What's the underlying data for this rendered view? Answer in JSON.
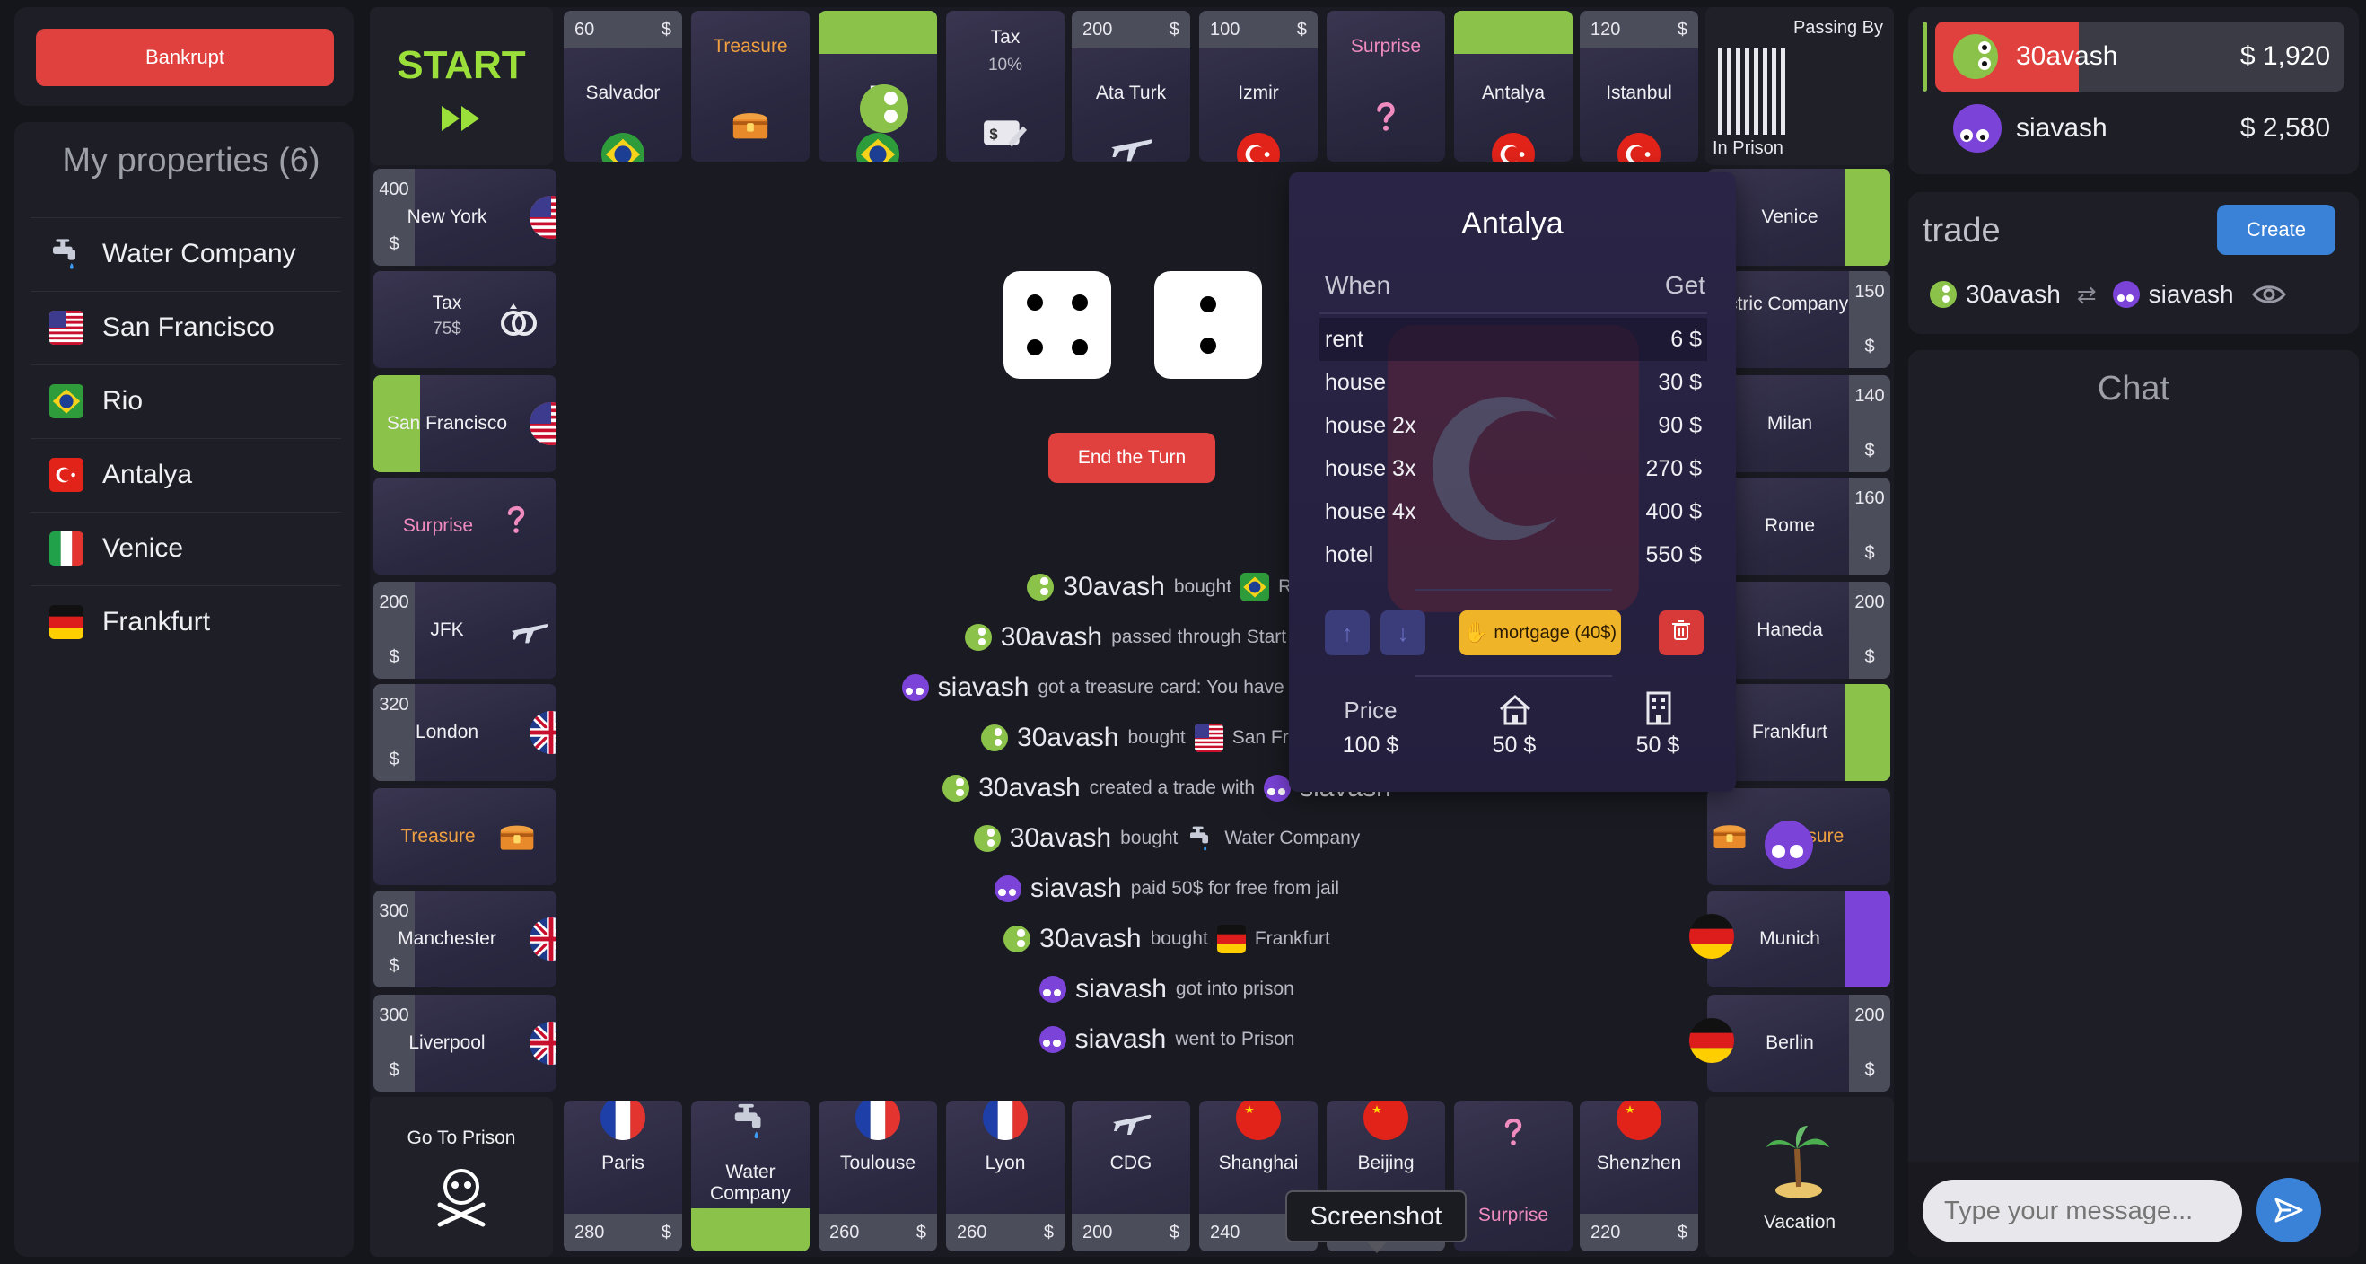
{
  "sidebar": {
    "bankrupt": "Bankrupt",
    "props_title": "My properties (6)",
    "properties": [
      {
        "label": "Water Company",
        "icon": "water-tap-icon"
      },
      {
        "label": "San Francisco",
        "icon": "flag-usa-icon"
      },
      {
        "label": "Rio",
        "icon": "flag-brazil-icon"
      },
      {
        "label": "Antalya",
        "icon": "flag-turkey-icon"
      },
      {
        "label": "Venice",
        "icon": "flag-italy-icon"
      },
      {
        "label": "Frankfurt",
        "icon": "flag-germany-icon"
      }
    ]
  },
  "board": {
    "start": "START",
    "top": [
      {
        "name": "Salvador",
        "price": "60",
        "cur": "$"
      },
      {
        "name": "Treasure"
      },
      {
        "name": "Ri"
      },
      {
        "name": "Tax",
        "sub": "10%"
      },
      {
        "name": "Ata Turk",
        "price": "200",
        "cur": "$"
      },
      {
        "name": "Izmir",
        "price": "100",
        "cur": "$"
      },
      {
        "name": "Surprise"
      },
      {
        "name": "Antalya"
      },
      {
        "name": "Istanbul",
        "price": "120",
        "cur": "$"
      }
    ],
    "passing_by": "Passing By",
    "in_prison": "In Prison",
    "left": [
      {
        "name": "New York",
        "price": "400",
        "cur": "$"
      },
      {
        "name": "Tax",
        "sub": "75$"
      },
      {
        "name": "San Francisco"
      },
      {
        "name": "Surprise"
      },
      {
        "name": "JFK",
        "price": "200",
        "cur": "$"
      },
      {
        "name": "London",
        "price": "320",
        "cur": "$"
      },
      {
        "name": "Treasure"
      },
      {
        "name": "Manchester",
        "price": "300",
        "cur": "$"
      },
      {
        "name": "Liverpool",
        "price": "300",
        "cur": "$"
      }
    ],
    "right": [
      {
        "name": "Venice"
      },
      {
        "name": "Electric Company",
        "price": "150",
        "cur": "$"
      },
      {
        "name": "Milan",
        "price": "140",
        "cur": "$"
      },
      {
        "name": "Rome",
        "price": "160",
        "cur": "$"
      },
      {
        "name": "Haneda",
        "price": "200",
        "cur": "$"
      },
      {
        "name": "Frankfurt"
      },
      {
        "name": "asure"
      },
      {
        "name": "Munich"
      },
      {
        "name": "Berlin",
        "price": "200",
        "cur": "$"
      }
    ],
    "go_to_prison": "Go To Prison",
    "bottom": [
      {
        "name": "Paris",
        "price": "280",
        "cur": "$"
      },
      {
        "name": "Water Company"
      },
      {
        "name": "Toulouse",
        "price": "260",
        "cur": "$"
      },
      {
        "name": "Lyon",
        "price": "260",
        "cur": "$"
      },
      {
        "name": "CDG",
        "price": "200",
        "cur": "$"
      },
      {
        "name": "Shanghai",
        "price": "240",
        "cur": "$"
      },
      {
        "name": "Beijing"
      },
      {
        "name": "Surprise"
      },
      {
        "name": "Shenzhen",
        "price": "220",
        "cur": "$"
      }
    ],
    "vacation": "Vacation",
    "end_turn": "End the Turn",
    "tooltip": "Screenshot"
  },
  "log": [
    {
      "who": "30avash",
      "act": "bought",
      "target": "Rio",
      "av": "green"
    },
    {
      "who": "30avash",
      "act": "passed through Start and recei",
      "target": "",
      "av": "green"
    },
    {
      "who": "siavash",
      "act": "got a treasure card: You have won third prize in",
      "target": "",
      "av": "purple"
    },
    {
      "who": "30avash",
      "act": "bought",
      "target": "San Francisco",
      "av": "green"
    },
    {
      "who": "30avash",
      "act": "created a trade with",
      "target": "siavash",
      "av": "green"
    },
    {
      "who": "30avash",
      "act": "bought",
      "target": "Water Company",
      "av": "green"
    },
    {
      "who": "siavash",
      "act": "paid 50$ for free from jail",
      "target": "",
      "av": "purple"
    },
    {
      "who": "30avash",
      "act": "bought",
      "target": "Frankfurt",
      "av": "green"
    },
    {
      "who": "siavash",
      "act": "got into prison",
      "target": "",
      "av": "purple"
    },
    {
      "who": "siavash",
      "act": "went to Prison",
      "target": "",
      "av": "purple"
    }
  ],
  "popup": {
    "title": "Antalya",
    "when": "When",
    "get": "Get",
    "rows": [
      {
        "k": "rent",
        "v": "6 $"
      },
      {
        "k": "house",
        "v": "30 $"
      },
      {
        "k": "house 2x",
        "v": "90 $"
      },
      {
        "k": "house 3x",
        "v": "270 $"
      },
      {
        "k": "house 4x",
        "v": "400 $"
      },
      {
        "k": "hotel",
        "v": "550 $"
      }
    ],
    "mortgage": "mortgage (40$)",
    "price_label": "Price",
    "price": "100 $",
    "house_cost": "50 $",
    "hotel_cost": "50 $"
  },
  "players": [
    {
      "name": "30avash",
      "money": "$ 1,920"
    },
    {
      "name": "siavash",
      "money": "$ 2,580"
    }
  ],
  "trade": {
    "title": "trade",
    "create": "Create",
    "from": "30avash",
    "to": "siavash"
  },
  "chat": {
    "title": "Chat",
    "placeholder": "Type your message..."
  }
}
